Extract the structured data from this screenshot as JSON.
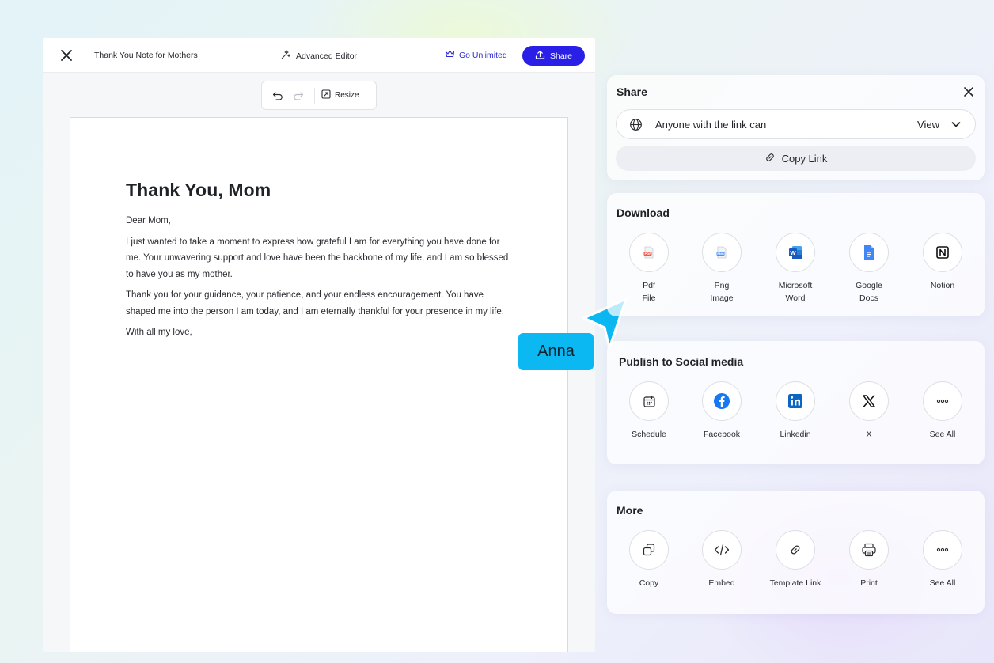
{
  "editor": {
    "doc_title": "Thank You Note for Mothers",
    "advanced_editor": "Advanced Editor",
    "go_unlimited": "Go Unlimited",
    "share": "Share",
    "resize": "Resize"
  },
  "letter": {
    "heading": "Thank You, Mom",
    "greeting": "Dear Mom,",
    "para1": "I just wanted to take a moment to express how grateful I am for everything you have done for me. Your unwavering support and love have been the backbone of my life, and I am so blessed to have you as my mother.",
    "para2": "Thank you for your guidance, your patience, and your endless encouragement. You have shaped me into the person I am today, and I am eternally thankful for your presence in my life.",
    "closing": "With all my love,"
  },
  "collaborator": {
    "name": "Anna",
    "color": "#0bb8f1"
  },
  "share_panel": {
    "title": "Share",
    "access_text": "Anyone with the link can",
    "access_level": "View",
    "copy_link": "Copy Link"
  },
  "download": {
    "title": "Download",
    "items": [
      {
        "label": "Pdf\nFile",
        "icon": "pdf-icon"
      },
      {
        "label": "Png\nImage",
        "icon": "png-icon"
      },
      {
        "label": "Microsoft\nWord",
        "icon": "word-icon"
      },
      {
        "label": "Google\nDocs",
        "icon": "google-docs-icon"
      },
      {
        "label": "Notion",
        "icon": "notion-icon"
      }
    ]
  },
  "social": {
    "title": "Publish to Social media",
    "items": [
      {
        "label": "Schedule",
        "icon": "calendar-icon"
      },
      {
        "label": "Facebook",
        "icon": "facebook-icon"
      },
      {
        "label": "Linkedin",
        "icon": "linkedin-icon"
      },
      {
        "label": "X",
        "icon": "x-icon"
      },
      {
        "label": "See All",
        "icon": "more-icon"
      }
    ]
  },
  "more": {
    "title": "More",
    "items": [
      {
        "label": "Copy",
        "icon": "copy-icon"
      },
      {
        "label": "Embed",
        "icon": "embed-icon"
      },
      {
        "label": "Template Link",
        "icon": "link-icon"
      },
      {
        "label": "Print",
        "icon": "printer-icon"
      },
      {
        "label": "See All",
        "icon": "more-icon"
      }
    ]
  },
  "colors": {
    "accent": "#2a1fe6",
    "link_text": "#2b2bd6",
    "word_blue": "#185abd",
    "docs_blue": "#4285f4",
    "facebook_blue": "#1877f2",
    "linkedin_blue": "#0a66c2"
  }
}
